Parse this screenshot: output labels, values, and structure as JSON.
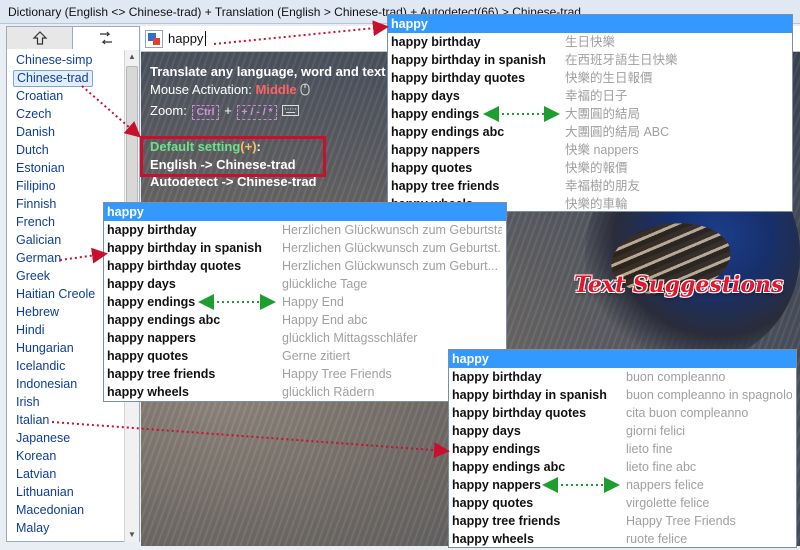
{
  "window": {
    "title": "Dictionary (English <> Chinese-trad) + Translation (English > Chinese-trad) + Autodetect(66) > Chinese-trad"
  },
  "sidebar": {
    "tabs": [
      {
        "icon": "home-arrow-icon"
      },
      {
        "icon": "swap-arrow-icon"
      }
    ],
    "languages": [
      "Chinese-simp",
      "Chinese-trad",
      "Croatian",
      "Czech",
      "Danish",
      "Dutch",
      "Estonian",
      "Filipino",
      "Finnish",
      "French",
      "Galician",
      "German",
      "Greek",
      "Haitian Creole",
      "Hebrew",
      "Hindi",
      "Hungarian",
      "Icelandic",
      "Indonesian",
      "Irish",
      "Italian",
      "Japanese",
      "Korean",
      "Latvian",
      "Lithuanian",
      "Macedonian",
      "Malay"
    ],
    "selected": "Chinese-trad"
  },
  "input": {
    "value": "happy"
  },
  "hints": {
    "line1": "Translate any language, word and text",
    "mouse_prefix": "Mouse Activation: ",
    "mouse_value": "Middle",
    "zoom_prefix": "Zoom:",
    "zoom_key": "Ctrl",
    "zoom_plus": "+",
    "zoom_ops": "+ / - / *",
    "default_label": "Default setting",
    "default_plus": "(+)",
    "default_colon": ":",
    "pair1": "English -> Chinese-trad",
    "pair2": "Autodetect -> Chinese-trad"
  },
  "caption": "Text Suggestions",
  "popups": {
    "chinese": {
      "header": "happy",
      "rows": [
        {
          "en": "happy birthday",
          "tr": "生日快樂"
        },
        {
          "en": "happy birthday in spanish",
          "tr": "在西班牙語生日快樂"
        },
        {
          "en": "happy birthday quotes",
          "tr": "快樂的生日報價"
        },
        {
          "en": "happy days",
          "tr": "幸福的日子"
        },
        {
          "en": "happy endings",
          "tr": "大團圓的結局"
        },
        {
          "en": "happy endings abc",
          "tr": "大團圓的結局 ABC"
        },
        {
          "en": "happy nappers",
          "tr": "快樂 nappers"
        },
        {
          "en": "happy quotes",
          "tr": "快樂的報價"
        },
        {
          "en": "happy tree friends",
          "tr": "幸福樹的朋友"
        },
        {
          "en": "happy wheels",
          "tr": "快樂的車輪"
        }
      ]
    },
    "german": {
      "header": "happy",
      "rows": [
        {
          "en": "happy birthday",
          "tr": "Herzlichen Glückwunsch zum Geburtstag"
        },
        {
          "en": "happy birthday in spanish",
          "tr": "Herzlichen Glückwunsch zum Geburtst..."
        },
        {
          "en": "happy birthday quotes",
          "tr": "Herzlichen Glückwunsch zum Geburt..."
        },
        {
          "en": "happy days",
          "tr": "glückliche Tage"
        },
        {
          "en": "happy endings",
          "tr": "Happy End"
        },
        {
          "en": "happy endings abc",
          "tr": "Happy End abc"
        },
        {
          "en": "happy nappers",
          "tr": "glücklich Mittagsschläfer"
        },
        {
          "en": "happy quotes",
          "tr": "Gerne zitiert"
        },
        {
          "en": "happy tree friends",
          "tr": "Happy Tree Friends"
        },
        {
          "en": "happy wheels",
          "tr": "glücklich Rädern"
        }
      ]
    },
    "italian": {
      "header": "happy",
      "rows": [
        {
          "en": "happy birthday",
          "tr": "buon compleanno"
        },
        {
          "en": "happy birthday in spanish",
          "tr": "buon compleanno in spagnolo"
        },
        {
          "en": "happy birthday quotes",
          "tr": "cita buon compleanno"
        },
        {
          "en": "happy days",
          "tr": "giorni felici"
        },
        {
          "en": "happy endings",
          "tr": "lieto fine"
        },
        {
          "en": "happy endings abc",
          "tr": "lieto fine abc"
        },
        {
          "en": "happy nappers",
          "tr": "nappers felice"
        },
        {
          "en": "happy quotes",
          "tr": "virgolette felice"
        },
        {
          "en": "happy tree friends",
          "tr": "Happy Tree Friends"
        },
        {
          "en": "happy wheels",
          "tr": "ruote felice"
        }
      ]
    }
  },
  "colors": {
    "highlight": "#3399ff",
    "annotation_red": "#c8102e",
    "annotation_green": "#1e9e2e",
    "link": "#0f3e9a"
  }
}
